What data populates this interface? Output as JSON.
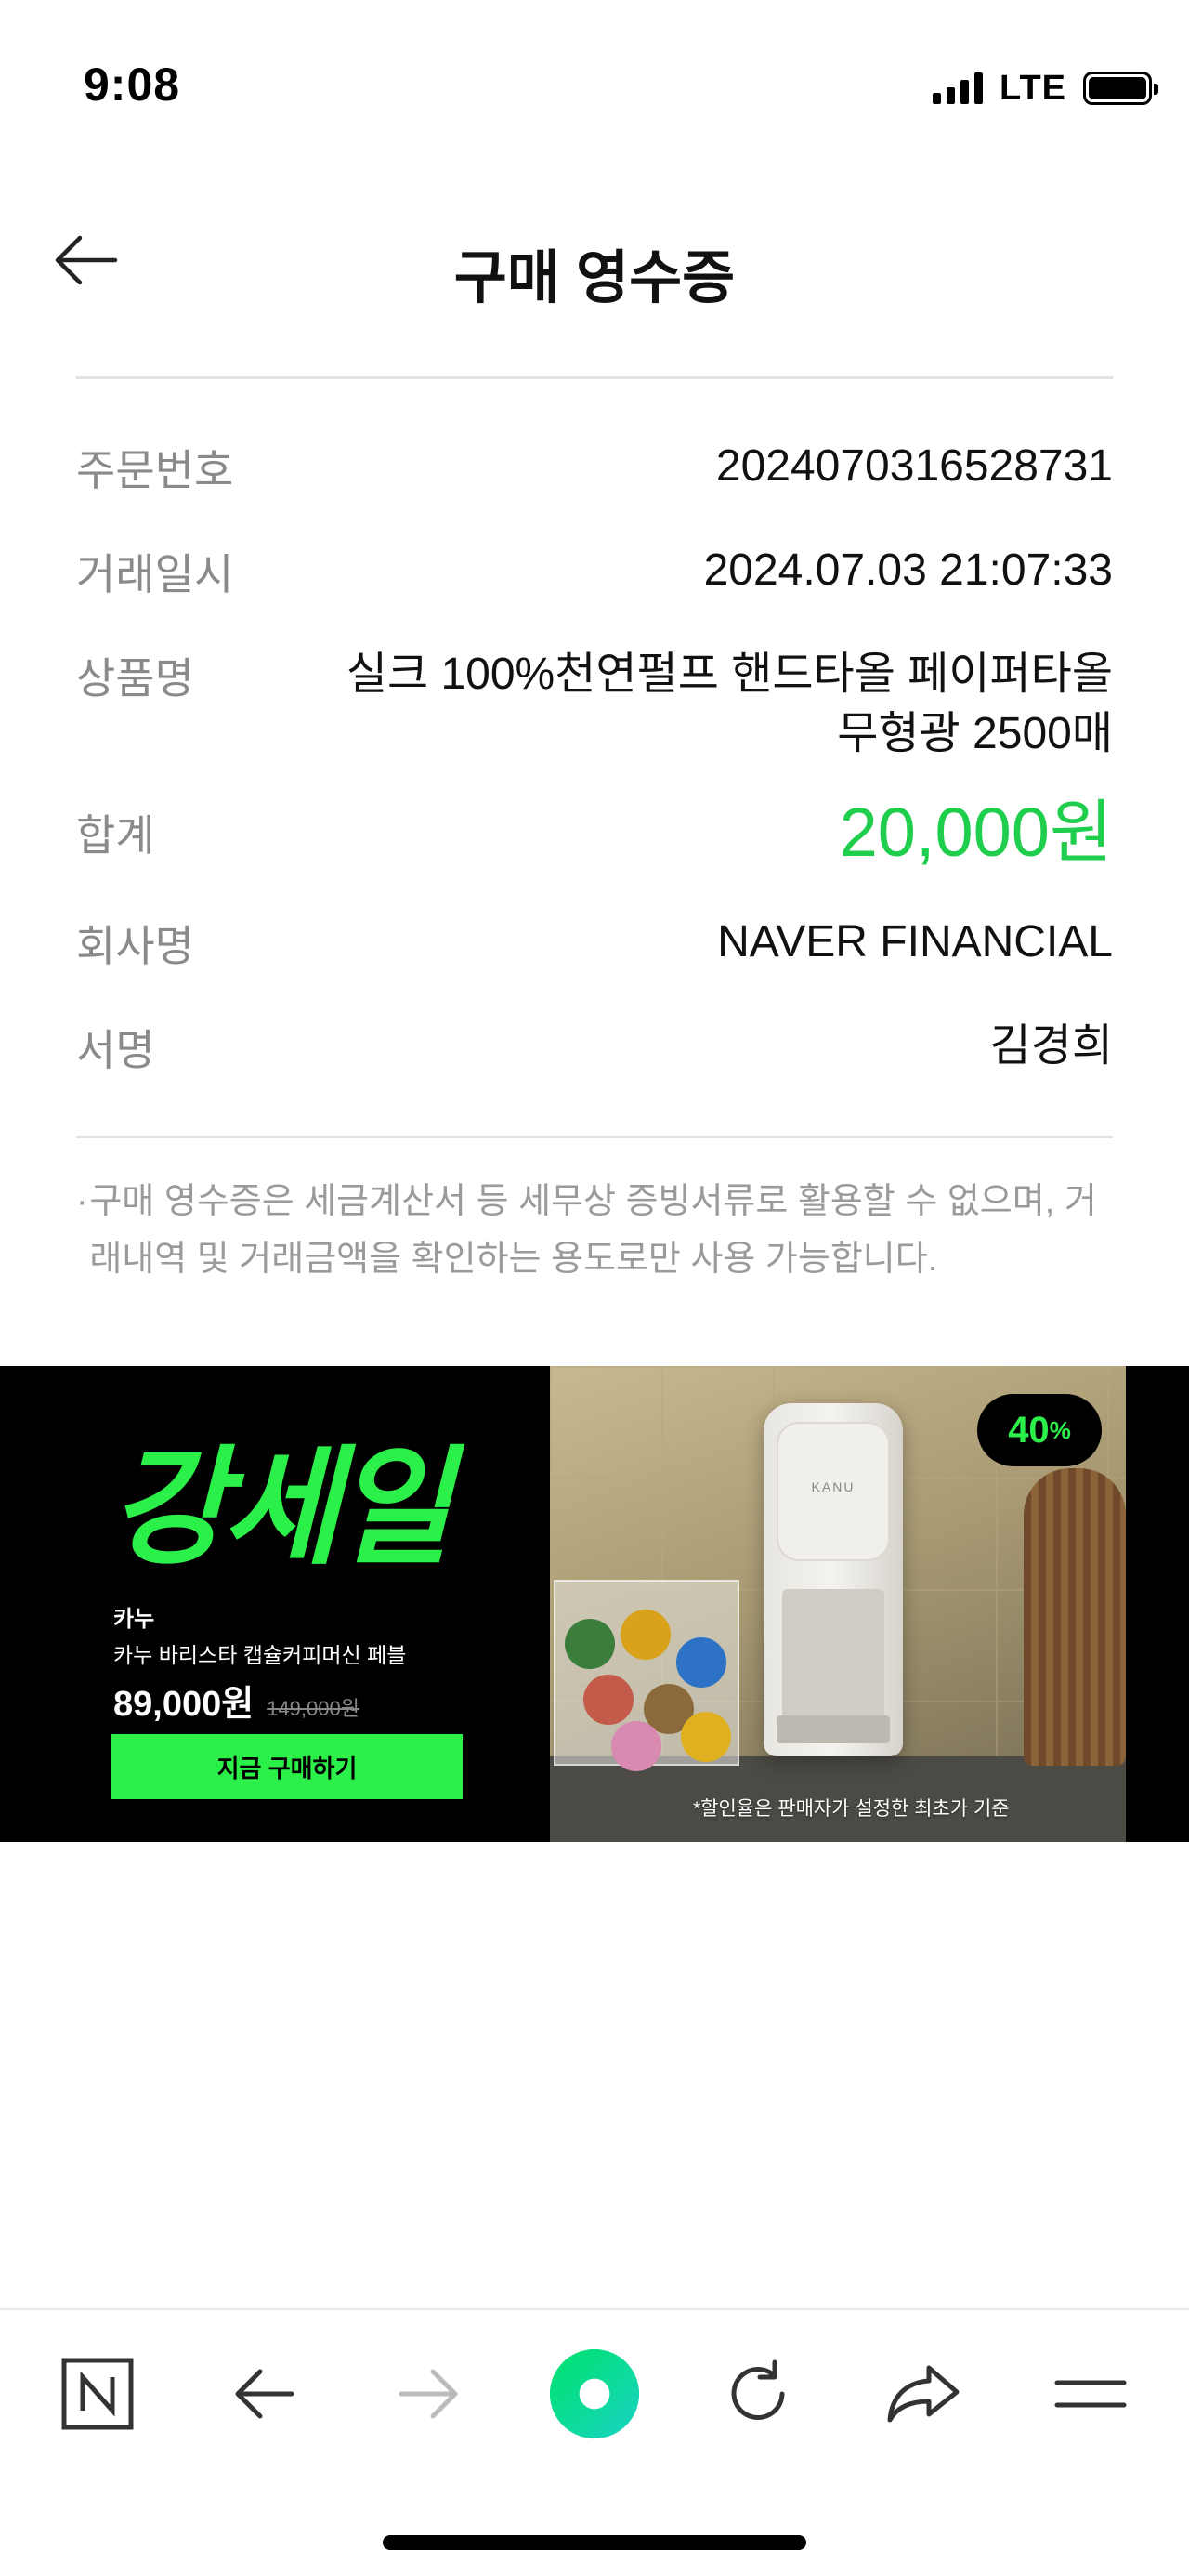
{
  "status_bar": {
    "time": "9:08",
    "network": "LTE"
  },
  "header": {
    "title": "구매 영수증",
    "back_icon": "arrow-left-icon"
  },
  "receipt": {
    "order_number_label": "주문번호",
    "order_number": "2024070316528731",
    "datetime_label": "거래일시",
    "datetime": "2024.07.03 21:07:33",
    "product_label": "상품명",
    "product_name": "실크 100%천연펄프 핸드타올 페이퍼타올 무형광 2500매",
    "total_label": "합계",
    "total": "20,000원",
    "total_color": "#1fce4c",
    "company_label": "회사명",
    "company": "NAVER FINANCIAL",
    "signature_label": "서명",
    "signature": "김경희"
  },
  "notice": {
    "bullet": "·",
    "text": "구매 영수증은 세금계산서 등 세무상 증빙서류로 활용할 수 없으며, 거래내역 및 거래금액을 확인하는 용도로만 사용 가능합니다."
  },
  "banner": {
    "logo_text": "강세일",
    "brand": "카누",
    "product": "카누 바리스타 캡슐커피머신 페블",
    "price": "89,000원",
    "original_price": "149,000원",
    "buy_label": "지금 구매하기",
    "discount_percent": "40",
    "discount_unit": "%",
    "machine_brand": "KANU",
    "discount_note": "*할인율은 판매자가 설정한 최초가 기준",
    "accent_color": "#2cf04a"
  },
  "toolbar": {
    "items": [
      "naver-home-icon",
      "back-arrow-icon",
      "forward-arrow-icon",
      "green-dot-icon",
      "refresh-icon",
      "share-icon",
      "menu-icon"
    ]
  }
}
